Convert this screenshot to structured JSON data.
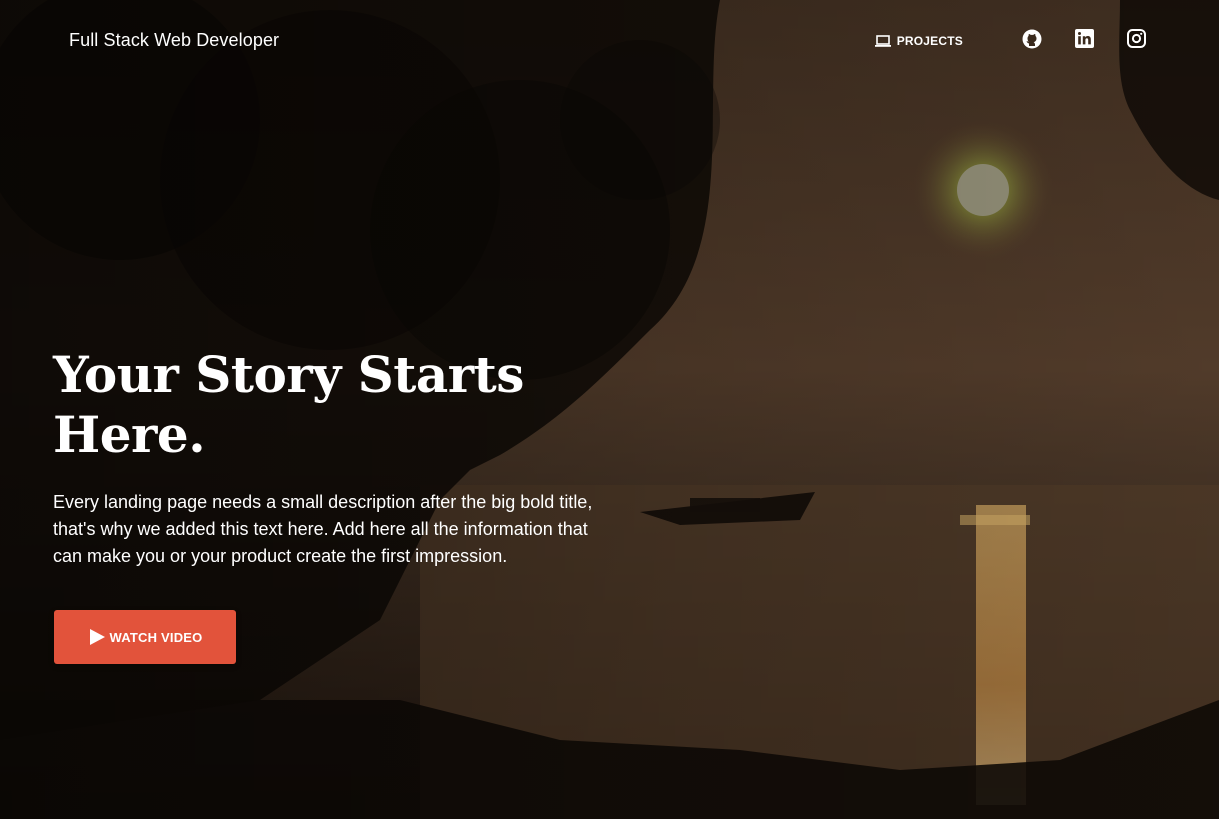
{
  "navbar": {
    "brand": "Full Stack Web Developer",
    "projects_label": "PROJECTS",
    "projects_icon": "laptop-icon",
    "social": [
      "github-icon",
      "linkedin-icon",
      "instagram-icon"
    ]
  },
  "hero": {
    "title": "Your Story Starts Here.",
    "description": "Every landing page needs a small description after the big bold title, that's why we added this text here. Add here all the information that can make you or your product create the first impression.",
    "button_label": "WATCH VIDEO",
    "button_icon": "play-icon",
    "button_color": "#e2533b"
  }
}
